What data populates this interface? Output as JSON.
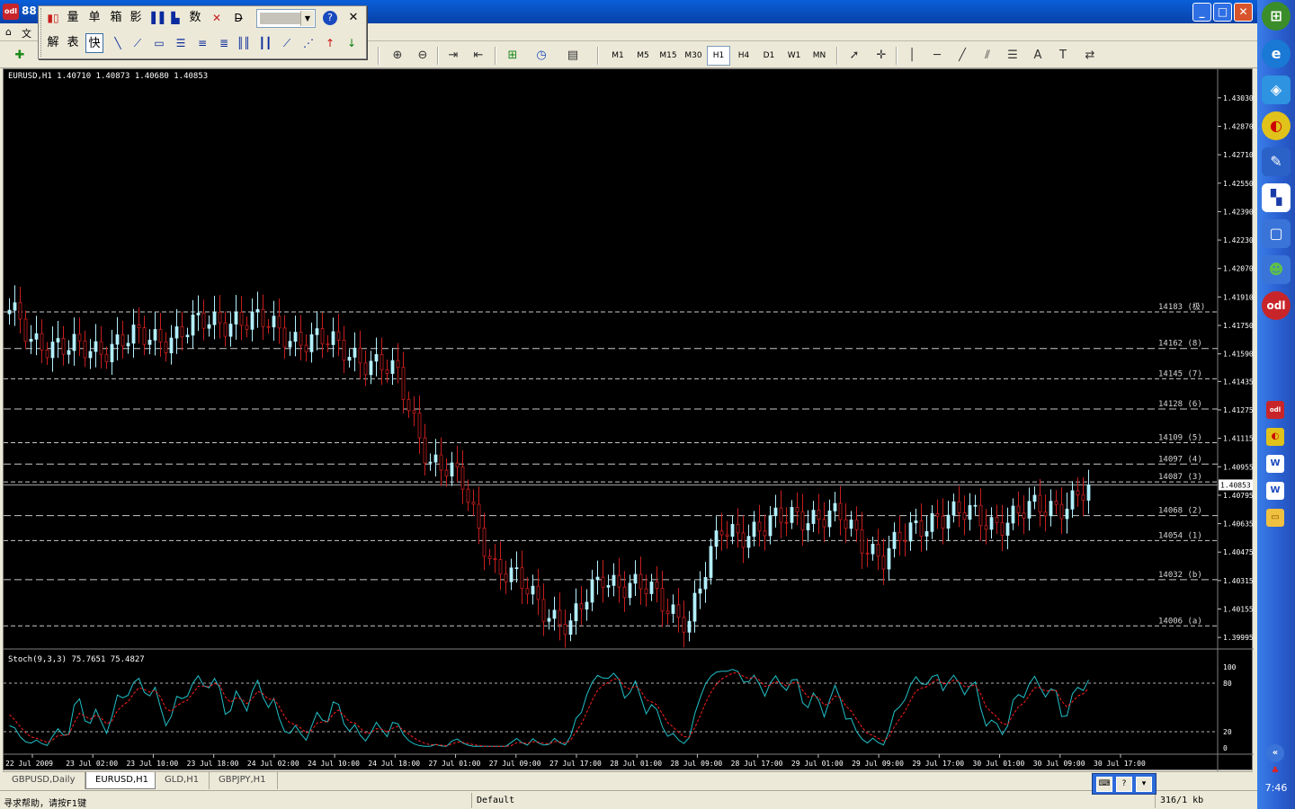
{
  "window": {
    "title": "88",
    "minimize": "_",
    "maximize": "□",
    "close": "✕"
  },
  "menubar": {
    "items": [
      "文"
    ]
  },
  "float_toolbar": {
    "row1": [
      "量",
      "单",
      "箱",
      "影",
      "数"
    ],
    "row2": [
      "解",
      "表",
      "快"
    ],
    "help_icon": "?",
    "close_icon": "✕",
    "combo_value": ""
  },
  "timeframes": [
    "M1",
    "M5",
    "M15",
    "M30",
    "H1",
    "H4",
    "D1",
    "W1",
    "MN"
  ],
  "active_timeframe": "H1",
  "toolbar_text_tools": [
    "A",
    "T"
  ],
  "chart": {
    "symbol_label": "EURUSD,H1  1.40710 1.40873 1.40680 1.40853",
    "current_price": "1.40853",
    "price_axis": [
      "1.43030",
      "1.42870",
      "1.42710",
      "1.42550",
      "1.42390",
      "1.42230",
      "1.42070",
      "1.41910",
      "1.41750",
      "1.41590",
      "1.41435",
      "1.41275",
      "1.41115",
      "1.40955",
      "1.40795",
      "1.40635",
      "1.40475",
      "1.40315",
      "1.40155",
      "1.39995"
    ],
    "levels": [
      {
        "label": "14183 (极)",
        "price": 1.41826
      },
      {
        "label": "14162 (8)",
        "price": 1.4162
      },
      {
        "label": "14145 (7)",
        "price": 1.4145
      },
      {
        "label": "14128 (6)",
        "price": 1.4128
      },
      {
        "label": "14109 (5)",
        "price": 1.4109
      },
      {
        "label": "14097 (4)",
        "price": 1.4097
      },
      {
        "label": "14087 (3)",
        "price": 1.4087
      },
      {
        "label": "14068 (2)",
        "price": 1.4068
      },
      {
        "label": "14054 (1)",
        "price": 1.4054
      },
      {
        "label": "14032 (b)",
        "price": 1.4032
      },
      {
        "label": "14006 (a)",
        "price": 1.4006
      }
    ],
    "time_axis": [
      "22 Jul 2009",
      "23 Jul 02:00",
      "23 Jul 10:00",
      "23 Jul 18:00",
      "24 Jul 02:00",
      "24 Jul 10:00",
      "24 Jul 18:00",
      "27 Jul 01:00",
      "27 Jul 09:00",
      "27 Jul 17:00",
      "28 Jul 01:00",
      "28 Jul 09:00",
      "28 Jul 17:00",
      "29 Jul 01:00",
      "29 Jul 09:00",
      "29 Jul 17:00",
      "30 Jul 01:00",
      "30 Jul 09:00",
      "30 Jul 17:00"
    ],
    "stoch_label": "Stoch(9,3,3) 75.7651 75.4827",
    "stoch_axis": [
      "100",
      "80",
      "20",
      "0"
    ],
    "colors": {
      "bull": "#b3f0ff",
      "bear": "#c81e1e",
      "main": "#20c0c8",
      "signal": "#ff2020",
      "level": "#c8c8c8"
    }
  },
  "tabs": [
    "GBPUSD,Daily",
    "EURUSD,H1",
    "GLD,H1",
    "GBPJPY,H1"
  ],
  "active_tab": "EURUSD,H1",
  "status": {
    "help": "寻求帮助，请按F1键",
    "profile": "Default",
    "traffic": "316/1 kb"
  },
  "tray": {
    "clock": "7:46"
  },
  "chart_data": {
    "type": "candlestick",
    "title": "EURUSD,H1",
    "ylim": [
      1.3999,
      1.431
    ],
    "series": [
      {
        "name": "EURUSD,H1",
        "values": []
      }
    ],
    "indicator": {
      "name": "Stoch(9,3,3)",
      "main": 75.7651,
      "signal": 75.4827,
      "levels": [
        20,
        80
      ],
      "ylim": [
        0,
        100
      ]
    }
  }
}
